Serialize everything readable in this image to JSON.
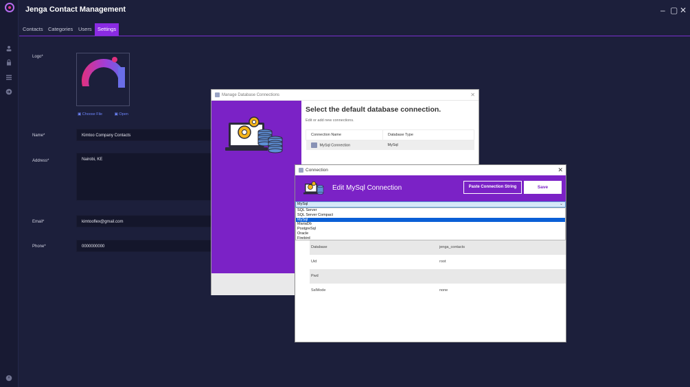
{
  "app": {
    "title": "Jenga Contact Management",
    "window_controls": {
      "minimize": "‒",
      "maximize": "▢",
      "close": "✕"
    }
  },
  "rail_icons": [
    "user-icon",
    "lock-icon",
    "list-icon",
    "logout-icon",
    "power-icon"
  ],
  "tabs": [
    {
      "label": "Contacts",
      "active": false
    },
    {
      "label": "Categories",
      "active": false
    },
    {
      "label": "Users",
      "active": false
    },
    {
      "label": "Settings",
      "active": true
    }
  ],
  "settings": {
    "logo_label": "Logo*",
    "choose_file": "Choose File",
    "open": "Open",
    "name_label": "Name*",
    "name_value": "Kimtoo Company Contacts",
    "address_label": "Address*",
    "address_value": "Nairobi, KE",
    "email_label": "Email*",
    "email_value": "kimtooflex@gmail.com",
    "phone_label": "Phone*",
    "phone_value": "0000000000"
  },
  "manage_dialog": {
    "title": "Manage Database Connections",
    "heading": "Select the default database connection.",
    "subheading": "Edit or add new connections.",
    "columns": [
      "Connection Name",
      "Database Type"
    ],
    "rows": [
      {
        "name": "MySql Connection",
        "type": "MySql"
      }
    ]
  },
  "connection_dialog": {
    "title": "Connection",
    "header": "Edit MySql Connection",
    "paste_button": "Paste Connection String",
    "save_button": "Save",
    "selected_type": "MySql",
    "options": [
      "SQL Server",
      "SQL Server Compact",
      "MySql",
      "MariaDb",
      "PostgreSql",
      "Oracle",
      "Firebird"
    ],
    "properties": [
      {
        "key": "Database",
        "value": "jenga_contacts"
      },
      {
        "key": "Uid",
        "value": "root"
      },
      {
        "key": "Pwd",
        "value": ""
      },
      {
        "key": "SslMode",
        "value": "none"
      }
    ]
  },
  "colors": {
    "background": "#1c1f3b",
    "accent": "#8a2be2",
    "dialog_purple": "#7b22c6"
  }
}
